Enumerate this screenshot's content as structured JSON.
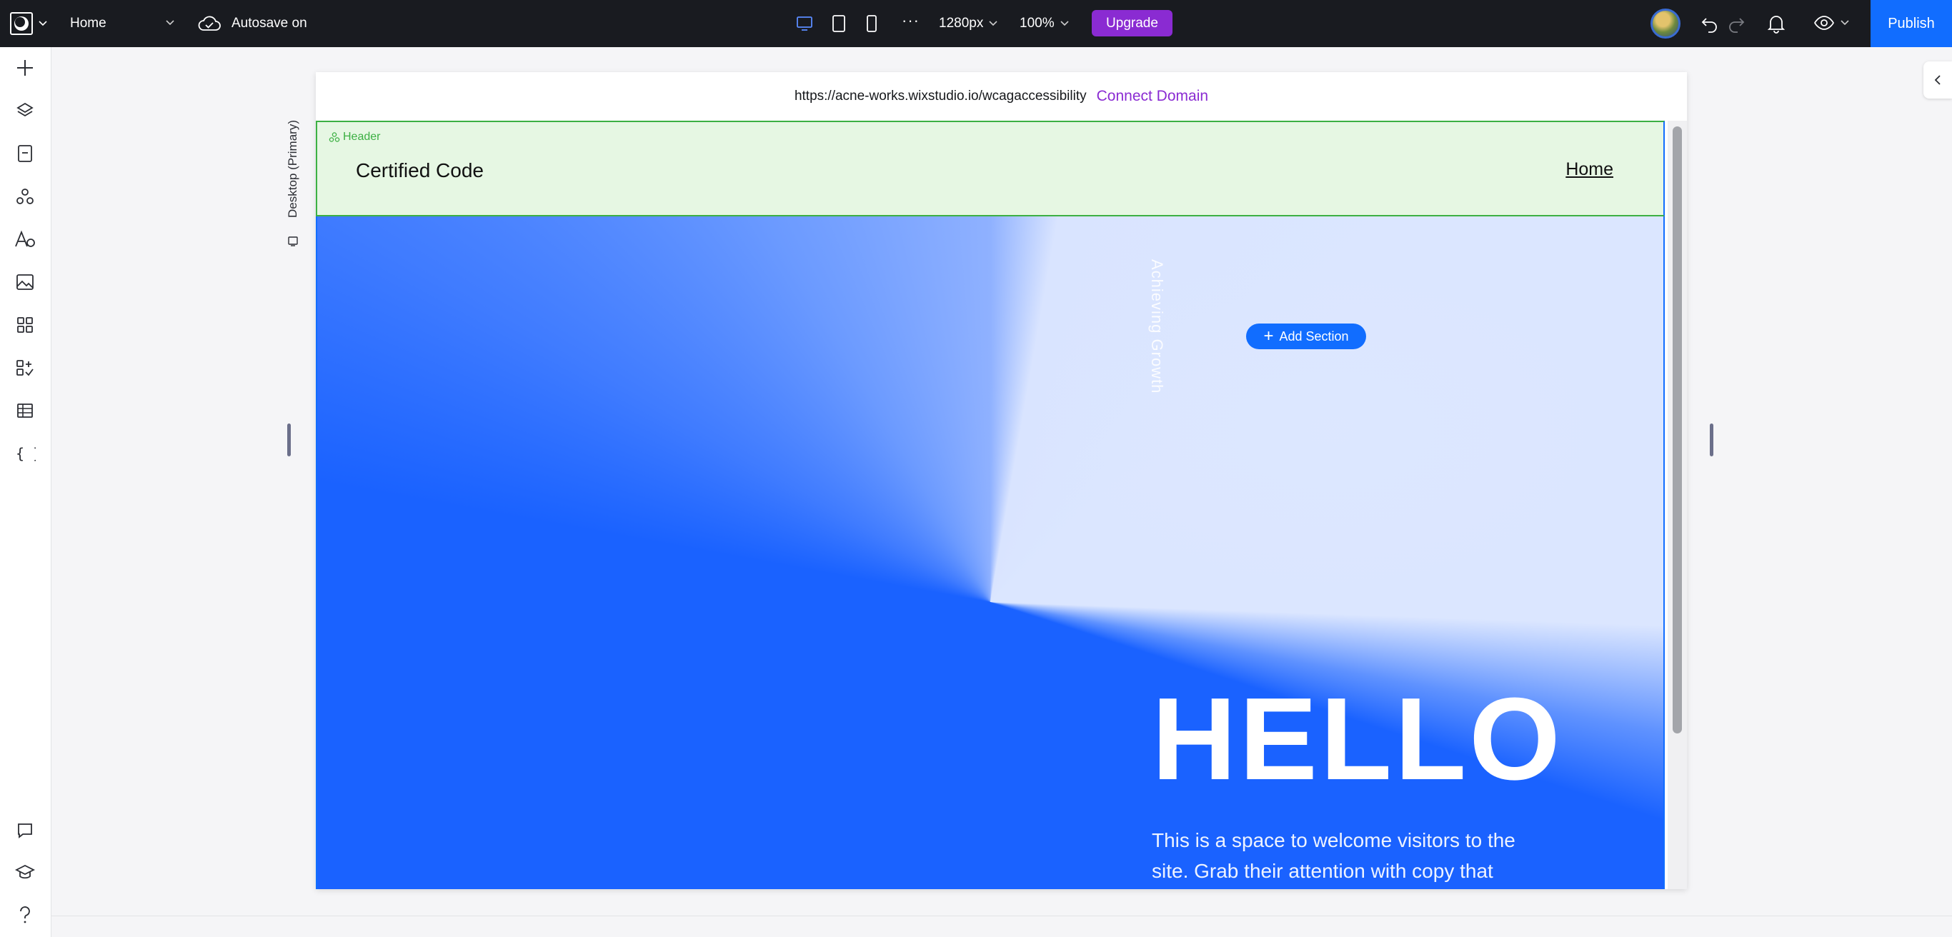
{
  "topbar": {
    "page_name": "Home",
    "autosave_label": "Autosave on",
    "width_value": "1280px",
    "zoom_value": "100%",
    "more_label": "···",
    "upgrade_label": "Upgrade",
    "publish_label": "Publish"
  },
  "sidebar": {
    "items": [
      "add-icon",
      "layers-icon",
      "pages-icon",
      "components-icon",
      "typography-icon",
      "media-icon",
      "apps-icon",
      "add-apps-icon",
      "cms-icon",
      "code-icon"
    ],
    "bottom_items": [
      "comments-icon",
      "learn-icon",
      "help-icon"
    ]
  },
  "canvas": {
    "breakpoint_label": "Desktop (Primary)",
    "url": "https://acne-works.wixstudio.io/wcagaccessibility",
    "connect_domain_label": "Connect Domain",
    "add_section_label": "Add Section"
  },
  "site": {
    "header_tag": "Header",
    "site_name": "Certified Code",
    "nav_home": "Home",
    "hero": {
      "vertical_text": "Achieving Growth",
      "headline": "HELLO",
      "copy": "This is a space to welcome visitors to the site. Grab their attention with copy that"
    }
  },
  "colors": {
    "topbar_bg": "#191b20",
    "accent_blue": "#116dff",
    "upgrade_purple": "#8a2bd2",
    "header_green": "#3cb043",
    "header_bg": "#e6f7e3",
    "hero_blue": "#1a62ff"
  }
}
